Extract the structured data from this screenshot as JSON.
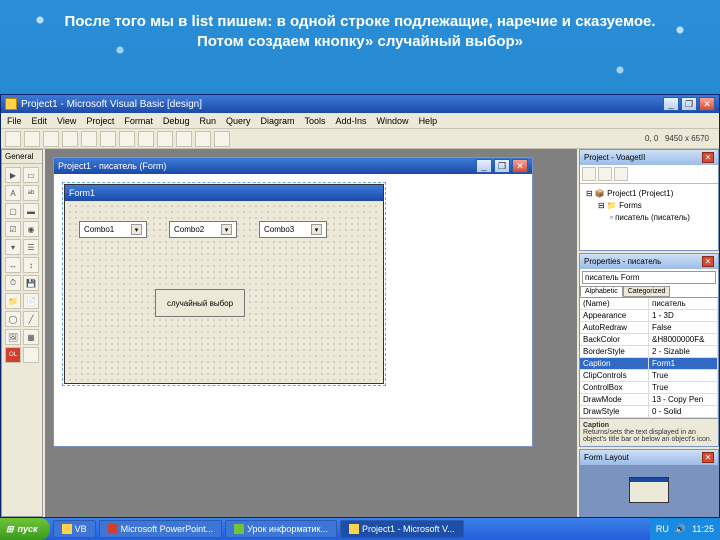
{
  "slide_title": "После того мы в list пишем: в одной строке подлежащие, наречие и сказуемое. Потом создаем кнопку» случайный выбор»",
  "vb": {
    "title": "Project1 - Microsoft Visual Basic [design]",
    "menu": [
      "File",
      "Edit",
      "View",
      "Project",
      "Format",
      "Debug",
      "Run",
      "Query",
      "Diagram",
      "Tools",
      "Add-Ins",
      "Window",
      "Help"
    ],
    "coords_label": "0, 0",
    "size_label": "9450 x 6570"
  },
  "toolbox": {
    "title": "General"
  },
  "project_panel": {
    "title": "Project - VoagetII",
    "node1": "Project1 (Project1)",
    "node2": "Forms",
    "node3": "писатель (писатель)"
  },
  "props": {
    "title": "Properties - писатель",
    "object": "писатель Form",
    "tab_alpha": "Alphabetic",
    "tab_cat": "Categorized",
    "rows": [
      {
        "k": "(Name)",
        "v": "писатель"
      },
      {
        "k": "Appearance",
        "v": "1 - 3D"
      },
      {
        "k": "AutoRedraw",
        "v": "False"
      },
      {
        "k": "BackColor",
        "v": "&H8000000F&"
      },
      {
        "k": "BorderStyle",
        "v": "2 - Sizable"
      },
      {
        "k": "Caption",
        "v": "Form1"
      },
      {
        "k": "ClipControls",
        "v": "True"
      },
      {
        "k": "ControlBox",
        "v": "True"
      },
      {
        "k": "DrawMode",
        "v": "13 - Copy Pen"
      },
      {
        "k": "DrawStyle",
        "v": "0 - Solid"
      }
    ],
    "desc_title": "Caption",
    "desc_text": "Returns/sets the text displayed in an object's title bar or below an object's icon."
  },
  "formlayout": {
    "title": "Form Layout"
  },
  "designer": {
    "title": "Project1 - писатель (Form)",
    "form_caption": "Form1",
    "combo1": "Combo1",
    "combo2": "Combo2",
    "combo3": "Combo3",
    "button": "случайный выбор"
  },
  "taskbar": {
    "start": "пуск",
    "tasks": [
      {
        "label": "VB"
      },
      {
        "label": "Microsoft PowerPoint..."
      },
      {
        "label": "Урок информатик..."
      },
      {
        "label": "Project1 - Microsoft V..."
      }
    ],
    "lang": "RU",
    "time": "11:25"
  }
}
